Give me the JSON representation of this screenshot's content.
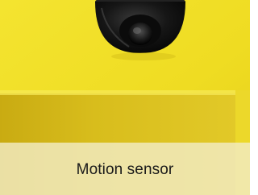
{
  "image": {
    "subject_icon": "dome-security-camera",
    "colors": {
      "background": "#efdc22",
      "lower_panel": "#d9bf1e",
      "camera_dome": "#111111",
      "caption_bar": "#f2ecc4",
      "caption_text": "#1a1a1a"
    }
  },
  "caption": {
    "text": "Motion sensor"
  }
}
